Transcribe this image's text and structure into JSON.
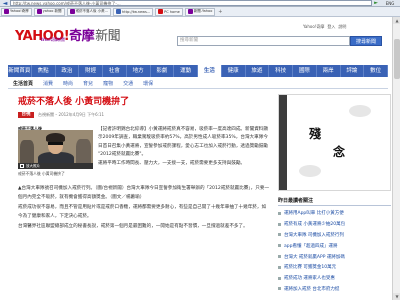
{
  "address": {
    "url": "http://tw.news.yahoo.com/戒菸不落人後-小黃司機拚了-...",
    "lang": "ENG"
  },
  "bookmarks": [
    {
      "label": "Yahoo!奇摩",
      "color": "#7b0099"
    },
    {
      "label": "yahoo 新聞",
      "color": "#7b0099"
    },
    {
      "label": "戒菸不落人後 小黃...",
      "color": "#7b0099"
    },
    {
      "label": "http://tw.news...",
      "color": "#3a62b5"
    },
    {
      "label": "PC home",
      "color": "#d40d12"
    },
    {
      "label": "新聞-Yahoo",
      "color": "#7b0099"
    }
  ],
  "logo": {
    "text": "YAHOO!",
    "ex": "奇摩",
    "section": "新聞",
    "sub": "Yahoo!奇摩新聞"
  },
  "toplinks": [
    "Yahoo!奇摩",
    "登入",
    "說明"
  ],
  "search": {
    "placeholder": "搜尋新聞",
    "button": "搜尋新聞"
  },
  "nav": [
    "新聞首頁",
    "焦點",
    "政治",
    "財經",
    "社會",
    "地方",
    "影劇",
    "運動",
    "生活",
    "健康",
    "旅遊",
    "科技",
    "國際",
    "兩岸",
    "評論",
    "數位"
  ],
  "nav_active": 8,
  "subnav": [
    "生活首頁",
    "消費",
    "時尚",
    "育兒",
    "寵物",
    "交通",
    "環保"
  ],
  "subnav_active": 0,
  "headline": "戒菸不落人後 小黃司機拚了",
  "source": {
    "logo": "台視",
    "text": "台視新聞 – 2012年4月9日 下午6:11"
  },
  "photo": {
    "top": "戒菸不落人後",
    "bar": "放大照片",
    "caption": "戒菸不落人後 小黃司機拚了"
  },
  "lead": [
    "【記者許明錦台北綜導】小黃運將戒菸真不容易，吸菸率一度高達四成。新聞資料顯示2009年調查，職業駕駛吸菸率約57%，高於男性成人吸菸率35%，台灣大車隊今日首日召集小黃運將，宣誓參加戒菸課程，愛心志工也加入戒菸行動，透過獎勵鼓勵 \"2012戒菸就贏比賽\"。",
    "運將平時工作時間長、壓力大，一支接一支，戒菸需要更多支持與鼓勵。"
  ],
  "body": [
    "▲台灣大車隊號召司機加入戒菸行列。（圖/台視新聞）台灣大車隊今日宣誓參加衛生署舉辦的「2012戒菸就贏比賽」，只要一個月內完全不吸菸，就有機會獲得高額獎金。（圖文／楊蕙瑜）",
    "戒菸成功很不容易，而且不管是用貼片或是戒菸口香糖，運將都需要更多耐心，有些是自己開了十幾年車抽了十幾年菸，如今為了健康和家人，下定決心戒菸。",
    "台灣醫界社區聯盟總部成立的秘書長說，戒菸第一個月是最困難的，一開始是有點不習慣，一旦撐過就差不多了。"
  ],
  "ad": {
    "line1": "殘",
    "line2": "念"
  },
  "side": {
    "title": "昨日最讀者關注",
    "items": [
      "運將用App叫車 比打小黃方便",
      "戒菸有成 小黃運將少抽20萬包",
      "台灣大車隊 司機加入戒菸行列",
      "app看懂「超過四成」運將",
      "台灣大 戒菸就贏APP 運將加碼",
      "戒菸比賽 可獲獎金10萬元",
      "戒菸成功 運將家人也受惠",
      "運將加入戒菸 台北市府力挺"
    ]
  }
}
